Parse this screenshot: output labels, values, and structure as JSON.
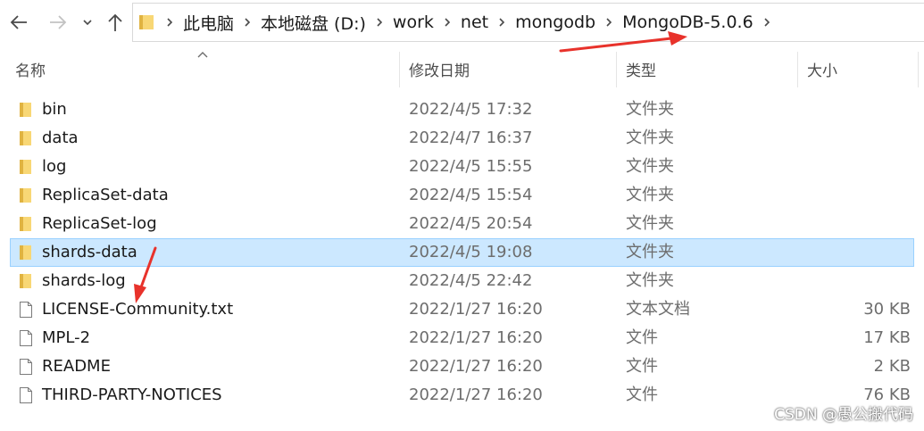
{
  "nav": {
    "back_icon": "arrow-left-icon",
    "forward_icon": "arrow-right-icon",
    "recent_icon": "chevron-down-icon",
    "up_icon": "arrow-up-icon"
  },
  "breadcrumb": [
    "此电脑",
    "本地磁盘 (D:)",
    "work",
    "net",
    "mongodb",
    "MongoDB-5.0.6"
  ],
  "columns": {
    "name": "名称",
    "date": "修改日期",
    "type": "类型",
    "size": "大小"
  },
  "files": [
    {
      "name": "bin",
      "date": "2022/4/5 17:32",
      "type": "文件夹",
      "size": "",
      "icon": "folder-icon"
    },
    {
      "name": "data",
      "date": "2022/4/7 16:37",
      "type": "文件夹",
      "size": "",
      "icon": "folder-icon"
    },
    {
      "name": "log",
      "date": "2022/4/5 15:55",
      "type": "文件夹",
      "size": "",
      "icon": "folder-icon"
    },
    {
      "name": "ReplicaSet-data",
      "date": "2022/4/5 15:54",
      "type": "文件夹",
      "size": "",
      "icon": "folder-icon"
    },
    {
      "name": "ReplicaSet-log",
      "date": "2022/4/5 20:54",
      "type": "文件夹",
      "size": "",
      "icon": "folder-icon"
    },
    {
      "name": "shards-data",
      "date": "2022/4/5 19:08",
      "type": "文件夹",
      "size": "",
      "icon": "folder-icon",
      "selected": true
    },
    {
      "name": "shards-log",
      "date": "2022/4/5 22:42",
      "type": "文件夹",
      "size": "",
      "icon": "folder-icon"
    },
    {
      "name": "LICENSE-Community.txt",
      "date": "2022/1/27 16:20",
      "type": "文本文档",
      "size": "30 KB",
      "icon": "file-icon"
    },
    {
      "name": "MPL-2",
      "date": "2022/1/27 16:20",
      "type": "文件",
      "size": "17 KB",
      "icon": "file-icon"
    },
    {
      "name": "README",
      "date": "2022/1/27 16:20",
      "type": "文件",
      "size": "2 KB",
      "icon": "file-icon"
    },
    {
      "name": "THIRD-PARTY-NOTICES",
      "date": "2022/1/27 16:20",
      "type": "文件",
      "size": "76 KB",
      "icon": "file-icon"
    }
  ],
  "watermark": "CSDN @愚公搬代码",
  "colors": {
    "selection_bg": "#cce8ff",
    "selection_border": "#99d1ff",
    "folder": "#f8d775",
    "annotation_arrow": "#e8322b"
  }
}
